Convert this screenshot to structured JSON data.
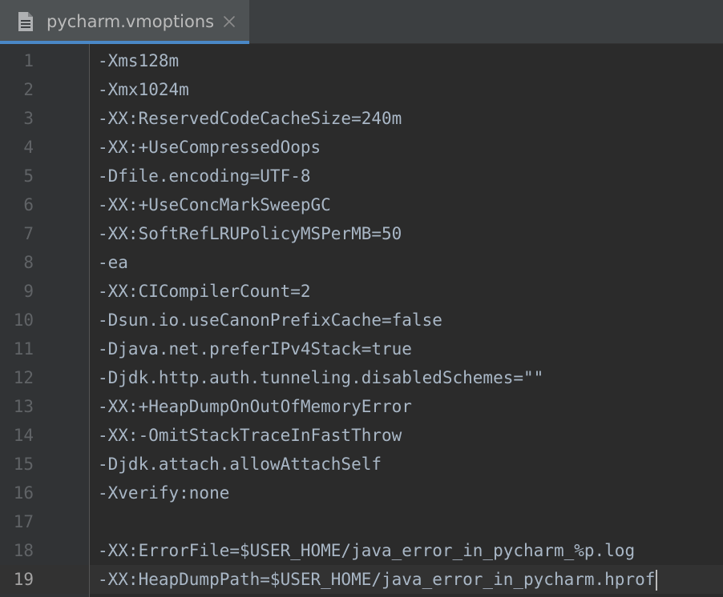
{
  "tab": {
    "filename": "pycharm.vmoptions",
    "icon": "file-text-icon",
    "close_icon": "close-icon"
  },
  "editor": {
    "current_line": 19,
    "lines": [
      {
        "num": "1",
        "text": "-Xms128m"
      },
      {
        "num": "2",
        "text": "-Xmx1024m"
      },
      {
        "num": "3",
        "text": "-XX:ReservedCodeCacheSize=240m"
      },
      {
        "num": "4",
        "text": "-XX:+UseCompressedOops"
      },
      {
        "num": "5",
        "text": "-Dfile.encoding=UTF-8"
      },
      {
        "num": "6",
        "text": "-XX:+UseConcMarkSweepGC"
      },
      {
        "num": "7",
        "text": "-XX:SoftRefLRUPolicyMSPerMB=50"
      },
      {
        "num": "8",
        "text": "-ea"
      },
      {
        "num": "9",
        "text": "-XX:CICompilerCount=2"
      },
      {
        "num": "10",
        "text": "-Dsun.io.useCanonPrefixCache=false"
      },
      {
        "num": "11",
        "text": "-Djava.net.preferIPv4Stack=true"
      },
      {
        "num": "12",
        "text": "-Djdk.http.auth.tunneling.disabledSchemes=\"\""
      },
      {
        "num": "13",
        "text": "-XX:+HeapDumpOnOutOfMemoryError"
      },
      {
        "num": "14",
        "text": "-XX:-OmitStackTraceInFastThrow"
      },
      {
        "num": "15",
        "text": "-Djdk.attach.allowAttachSelf"
      },
      {
        "num": "16",
        "text": "-Xverify:none"
      },
      {
        "num": "17",
        "text": ""
      },
      {
        "num": "18",
        "text": "-XX:ErrorFile=$USER_HOME/java_error_in_pycharm_%p.log"
      },
      {
        "num": "19",
        "text": "-XX:HeapDumpPath=$USER_HOME/java_error_in_pycharm.hprof"
      }
    ]
  },
  "colors": {
    "background": "#2b2b2b",
    "gutter": "#313335",
    "text": "#a9b7c6",
    "line_number": "#606366",
    "tab_underline": "#4a88c7"
  }
}
